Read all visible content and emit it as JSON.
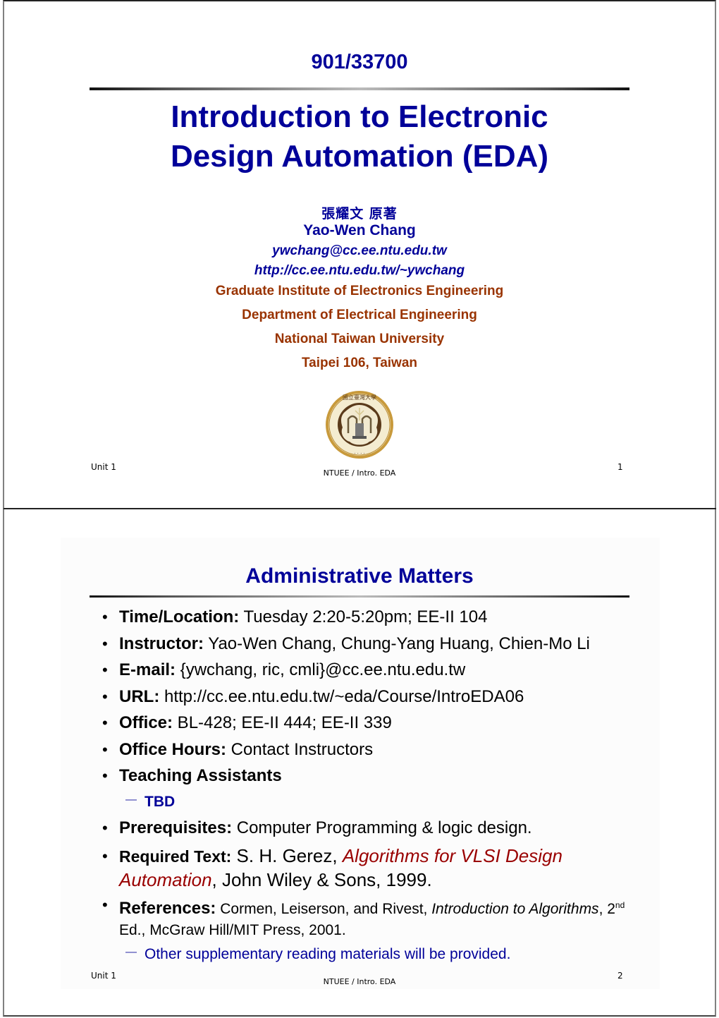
{
  "slide1": {
    "course_code": "901/33700",
    "title_line1": "Introduction to Electronic",
    "title_line2": "Design Automation (EDA)",
    "author_chinese": "張耀文 原著",
    "author_name": "Yao-Wen Chang",
    "author_email": "ywchang@cc.ee.ntu.edu.tw",
    "author_homepage": "http://cc.ee.ntu.edu.tw/~ywchang",
    "affiliations": [
      "Graduate Institute of Electronics Engineering",
      "Department of Electrical Engineering",
      "National Taiwan University",
      "Taipei 106, Taiwan"
    ],
    "seal_icon": "ntu-seal-icon",
    "seal_text": "國立臺灣大學",
    "footer": {
      "unit": "Unit 1",
      "center": "NTUEE / Intro. EDA",
      "page": "1"
    }
  },
  "slide2": {
    "title": "Administrative Matters",
    "bullets": [
      {
        "label": "Time/Location:",
        "text": " Tuesday 2:20-5:20pm; EE-II 104"
      },
      {
        "label": "Instructor:",
        "text": " Yao-Wen Chang, Chung-Yang Huang, Chien-Mo Li"
      },
      {
        "label": "E-mail:",
        "text": " {ywchang, ric, cmli}@cc.ee.ntu.edu.tw"
      },
      {
        "label": "URL:",
        "text": " http://cc.ee.ntu.edu.tw/~eda/Course/IntroEDA06"
      },
      {
        "label": "Office:",
        "text": " BL-428; EE-II 444; EE-II 339"
      },
      {
        "label": "Office Hours:",
        "text": " Contact Instructors"
      },
      {
        "label": "Teaching Assistants",
        "text": ""
      },
      {
        "label": "Prerequisites:",
        "text": " Computer Programming & logic design."
      }
    ],
    "ta_sub": "TBD",
    "required_text": {
      "label": "Required Text:",
      "author": " S. H. Gerez, ",
      "book": "Algorithms for VLSI Design Automation",
      "rest": ", John Wiley & Sons, 1999."
    },
    "references": {
      "label": "References:",
      "authors": " Cormen, Leiserson, and Rivest, ",
      "book": "Introduction to Algorithms",
      "edition_num": ", 2",
      "edition_sup": "nd",
      "rest": " Ed., McGraw Hill/MIT Press, 2001."
    },
    "ref_sub": "Other supplementary reading materials will be provided.",
    "footer": {
      "unit": "Unit 1",
      "center": "NTUEE / Intro. EDA",
      "page": "2"
    }
  },
  "colors": {
    "title_blue": "#000099",
    "affiliation_brown": "#993300",
    "book_red": "#990000"
  }
}
